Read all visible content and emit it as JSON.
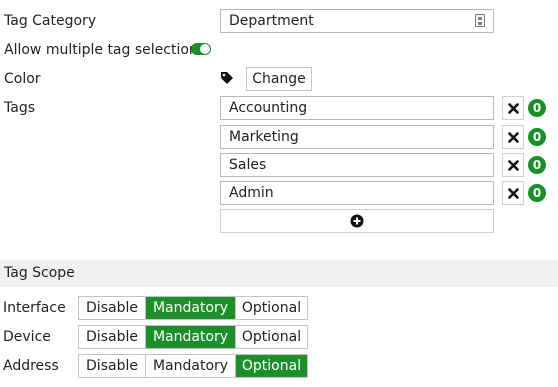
{
  "form": {
    "tag_category_label": "Tag Category",
    "tag_category_value": "Department",
    "allow_multiple_label": "Allow multiple tag selection",
    "allow_multiple_enabled": true,
    "color_label": "Color",
    "change_button": "Change",
    "tags_label": "Tags"
  },
  "tags": [
    {
      "name": "Accounting",
      "count": "0"
    },
    {
      "name": "Marketing",
      "count": "0"
    },
    {
      "name": "Sales",
      "count": "0"
    },
    {
      "name": "Admin",
      "count": "0"
    }
  ],
  "tag_scope": {
    "header": "Tag Scope",
    "options": [
      "Disable",
      "Mandatory",
      "Optional"
    ],
    "rows": [
      {
        "label": "Interface",
        "selected": "Mandatory"
      },
      {
        "label": "Device",
        "selected": "Mandatory"
      },
      {
        "label": "Address",
        "selected": "Optional"
      }
    ]
  },
  "colors": {
    "accent_green": "#1c8f2b",
    "section_bg": "#f0f0f0"
  },
  "icons": {
    "field_icon": "id-card-icon",
    "color_icon": "tag-icon",
    "delete_icon": "close-x-icon",
    "add_icon": "plus-circle-icon"
  }
}
